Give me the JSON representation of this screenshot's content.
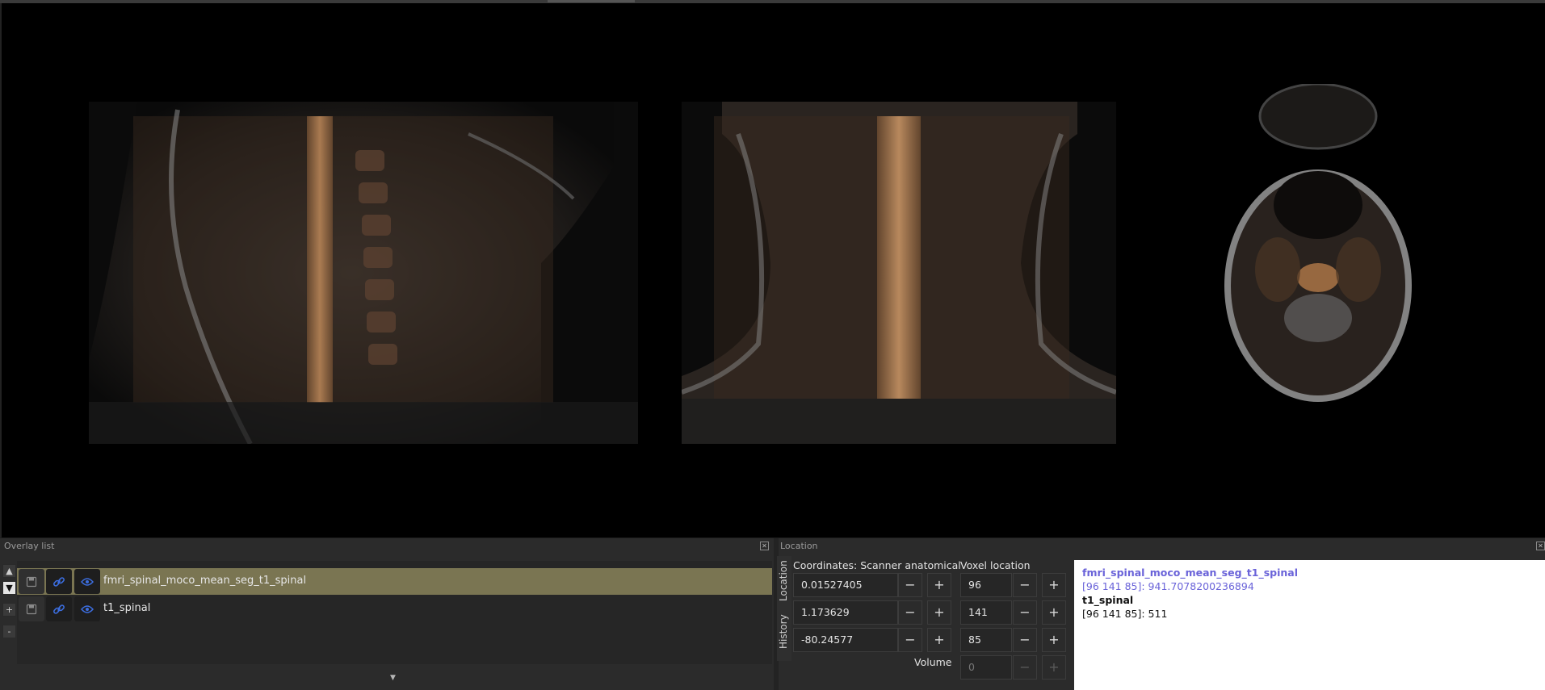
{
  "overlay_panel": {
    "title": "Overlay list",
    "close_icon": "close-icon",
    "controls": {
      "up": "▲",
      "down": "▼",
      "add": "+",
      "remove": "-"
    },
    "scroll_up": "▲",
    "scroll_down": "▼",
    "items": [
      {
        "name": "fmri_spinal_moco_mean_seg_t1_spinal",
        "selected": true
      },
      {
        "name": "t1_spinal",
        "selected": false
      }
    ]
  },
  "location_panel": {
    "title": "Location",
    "tabs": {
      "location": "Location",
      "history": "History"
    },
    "coordinates_label": "Coordinates: Scanner anatomical",
    "voxel_label": "Voxel location",
    "volume_label": "Volume",
    "coordinates": [
      "0.01527405",
      "1.173629",
      "-80.24577"
    ],
    "voxels": [
      "96",
      "141",
      "85"
    ],
    "volume_value": "0",
    "minus": "−",
    "plus": "+"
  },
  "info_panel": {
    "overlay1_name": "fmri_spinal_moco_mean_seg_t1_spinal",
    "overlay1_value": "[96 141 85]: 941.7078200236894",
    "overlay2_name": "t1_spinal",
    "overlay2_value": "[96 141 85]: 511",
    "highlight_color": "#6a63d9"
  },
  "colors": {
    "selected_row": "#7a7552",
    "eye_icon": "#3c6ee0",
    "link_icon": "#3c6ee0"
  }
}
